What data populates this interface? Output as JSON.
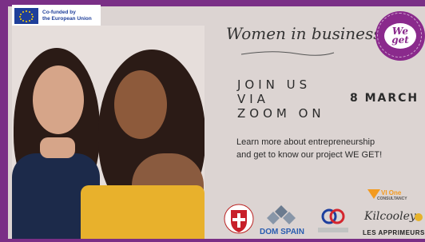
{
  "eu_badge": {
    "line1": "Co-funded by",
    "line2": "the European Union"
  },
  "header": {
    "title": "Women in business",
    "logo_text": "We get"
  },
  "event": {
    "join_line1": "JOIN US",
    "join_line2": "VIA",
    "join_line3": "ZOOM ON",
    "date": "8 MARCH",
    "description_line1": "Learn more about entrepreneurship",
    "description_line2": "and get to know our project WE GET!"
  },
  "partners": {
    "dom_spain": "DOM SPAIN",
    "vi_one": "VI One",
    "vi_one_sub": "CONSULTANCY",
    "kilcooley": "Kilcooley",
    "les_apprimeurs": "LES APPRIMEURS"
  },
  "colors": {
    "frame": "#7a2f86",
    "background": "#dcd4d2",
    "accent": "#8a2a8c",
    "eu_blue": "#1f3f9a"
  }
}
